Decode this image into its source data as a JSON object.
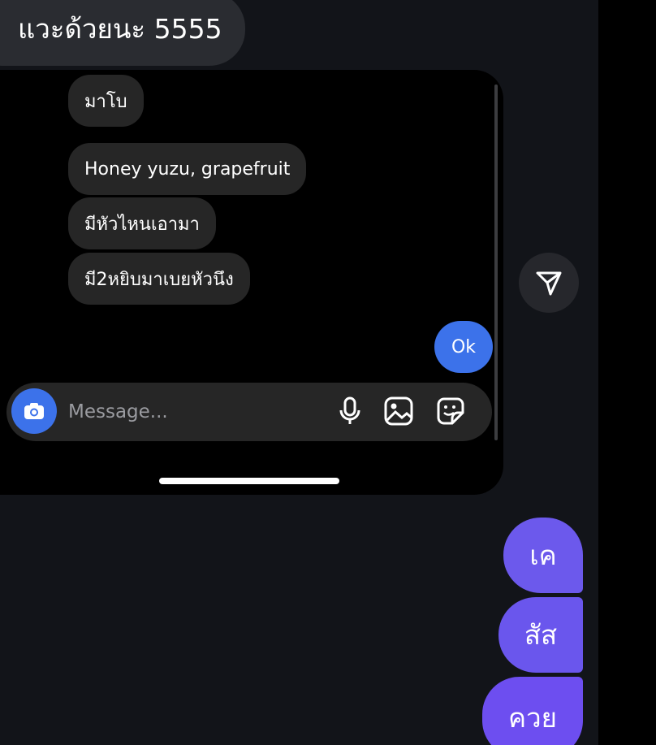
{
  "top_message": {
    "text": "แวะด้วยนะ 5555"
  },
  "story": {
    "messages": [
      {
        "text": "มาโบ"
      },
      {
        "text": "Honey yuzu, grapefruit"
      },
      {
        "text": "มีหัวไหนเอามา"
      },
      {
        "text": "มี2หยิบมาเบยหัวนึง"
      }
    ],
    "reply": {
      "text": "Ok"
    },
    "composer": {
      "placeholder": "Message...",
      "icons": [
        "camera-icon",
        "microphone-icon",
        "image-icon",
        "sticker-icon"
      ]
    }
  },
  "send_icon": "send-icon",
  "sent_messages": [
    {
      "text": "เค"
    },
    {
      "text": "สัส"
    },
    {
      "text": "ควย"
    }
  ],
  "colors": {
    "background": "#121419",
    "incoming_bubble": "#2a2c31",
    "ok_bubble": "#3c72ea",
    "sent_bubble": "#6c59ec"
  }
}
